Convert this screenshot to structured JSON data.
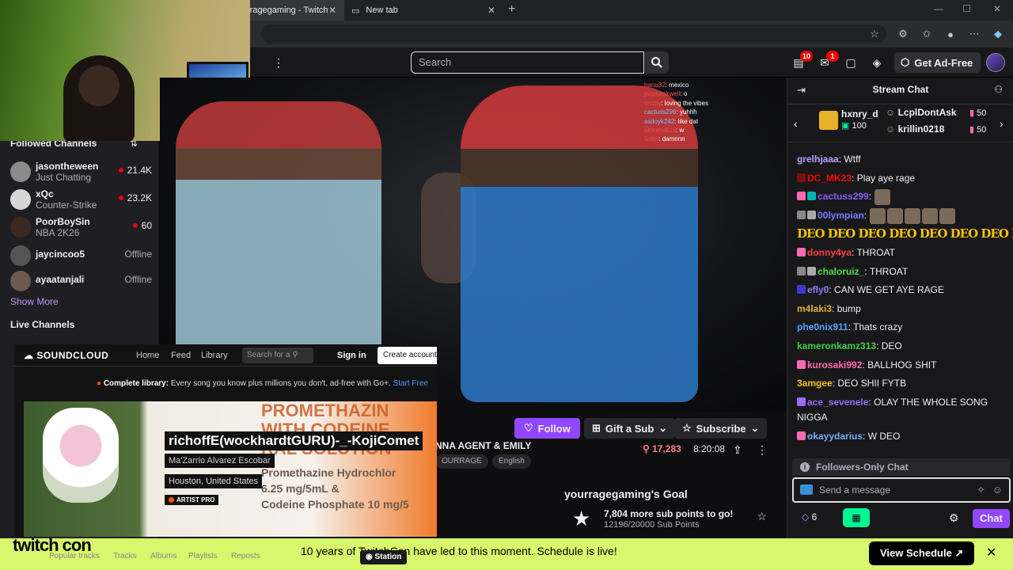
{
  "browser": {
    "tabs": [
      {
        "label": "rragegaming - Twitch"
      },
      {
        "label": "New tab"
      }
    ]
  },
  "topnav": {
    "search_placeholder": "Search",
    "notif_count": "10",
    "inbox_count": "1",
    "ad_free_label": "Get Ad-Free"
  },
  "sidebar": {
    "followed_heading": "Followed Channels",
    "channels": [
      {
        "name": "jasontheween",
        "game": "Just Chatting",
        "viewers": "21.4K",
        "live": true
      },
      {
        "name": "xQc",
        "game": "Counter-Strike",
        "viewers": "23.2K",
        "live": true
      },
      {
        "name": "PoorBoySin",
        "game": "NBA 2K26",
        "viewers": "60",
        "live": true
      },
      {
        "name": "jaycincoo5",
        "status": "Offline",
        "live": false
      },
      {
        "name": "ayaatanjali",
        "status": "Offline",
        "live": false
      }
    ],
    "show_more": "Show More",
    "live_heading": "Live Channels"
  },
  "video_overlay_chat": [
    {
      "user": "hanu32",
      "text": "mexico"
    },
    {
      "user": "jaxpiumkwell",
      "text": "o"
    },
    {
      "user": "crozty",
      "text": "loving the vibes"
    },
    {
      "user": "cactuss299",
      "text": "yuhhh"
    },
    {
      "user": "ssdoyk242",
      "text": "like dat"
    },
    {
      "user": "ninkehabzil",
      "text": "w"
    },
    {
      "user": "Sotel",
      "text": "damnnn"
    }
  ],
  "stream_info": {
    "follow_label": "Follow",
    "gift_label": "Gift a Sub",
    "subscribe_label": "Subscribe",
    "title_partial": "NNA AGENT & EMILY",
    "tags": [
      "OURRAGE",
      "English"
    ],
    "viewers": "17,283",
    "uptime": "8:20:08",
    "goal_title": "yourragegaming's Goal",
    "goal_line": "7,804 more sub points to go!",
    "goal_progress": "12196/20000 Sub Points"
  },
  "soundcloud": {
    "logo": "SOUNDCLOUD",
    "nav": [
      "Home",
      "Feed",
      "Library"
    ],
    "search_placeholder": "Search for a",
    "signin": "Sign in",
    "create": "Create account",
    "banner_bold": "Complete library:",
    "banner_text": " Every song you know plus millions you don't, ad-free with Go+.",
    "banner_link": "Start Free",
    "track_title": "richoffE(wockhardtGURU)-_-KojiComet",
    "artist": "Ma'Zarrio Alvarez Escobar",
    "location": "Houston, United States",
    "badge": "ARTIST PRO",
    "bg_lines": [
      "PROMETHAZIN",
      "WITH CODEINE",
      "RAL SOLUTION"
    ],
    "bg_lines2": [
      "Promethazine Hydrochlor",
      "6.25 mg/5mL &",
      "Codeine Phosphate 10 mg/5"
    ],
    "tabs": [
      "Popular tracks",
      "Tracks",
      "Albums",
      "Playlists",
      "Reposts"
    ],
    "station": "Station"
  },
  "bottom_banner": {
    "logo": "twitch con",
    "message": "10 years of TwitchCon have led to this moment. Schedule is live!",
    "button": "View Schedule",
    "close": "✕"
  },
  "chat": {
    "title": "Stream Chat",
    "leaderboard": [
      {
        "name": "hxnry_d",
        "value": "100"
      },
      {
        "name": "LcplDontAsk",
        "value": "50"
      },
      {
        "name": "krillin0218",
        "value": "50"
      }
    ],
    "messages": [
      {
        "user": "grelhjaaa",
        "color": "#b9a3ff",
        "text": "Wtff"
      },
      {
        "user": "DC_MK23",
        "color": "#ff0000",
        "text": "Play aye rage"
      },
      {
        "user": "cactuss299",
        "color": "#8a5cf5",
        "text": ""
      },
      {
        "user": "00lympian",
        "color": "#7a7aff",
        "text": ""
      },
      {
        "user": "",
        "color": "#f5c400",
        "text": "DEO DEO DEO DEO DEO DEO   DEO DEO"
      },
      {
        "user": "donny4ya",
        "color": "#ff4040",
        "text": "THROAT"
      },
      {
        "user": "chaloruiz_",
        "color": "#50e050",
        "text": "THROAT"
      },
      {
        "user": "efly0",
        "color": "#9a7cff",
        "text": "CAN WE GET AYE RAGE"
      },
      {
        "user": "m4laki3",
        "color": "#e0b040",
        "text": "bump"
      },
      {
        "user": "phe0nix911",
        "color": "#5aa0ff",
        "text": "Thats crazy"
      },
      {
        "user": "kameronkamz313",
        "color": "#40d040",
        "text": "DEO"
      },
      {
        "user": "kurosaki992",
        "color": "#ff6ab0",
        "text": "BALLHOG SHIT"
      },
      {
        "user": "3amgee",
        "color": "#f0c020",
        "text": "DEO SHII FYTB"
      },
      {
        "user": "ace_sevenele",
        "color": "#9a6cff",
        "text": "OLAY THE WHOLE SONG"
      },
      {
        "user": "",
        "color": "#efeff1",
        "text": "NIGGA"
      },
      {
        "user": "okayydarius",
        "color": "#7aa8ff",
        "text": "W DEO"
      }
    ],
    "followers_only": "Followers-Only Chat",
    "input_placeholder": "Send a message",
    "bits": "6",
    "send_label": "Chat"
  }
}
